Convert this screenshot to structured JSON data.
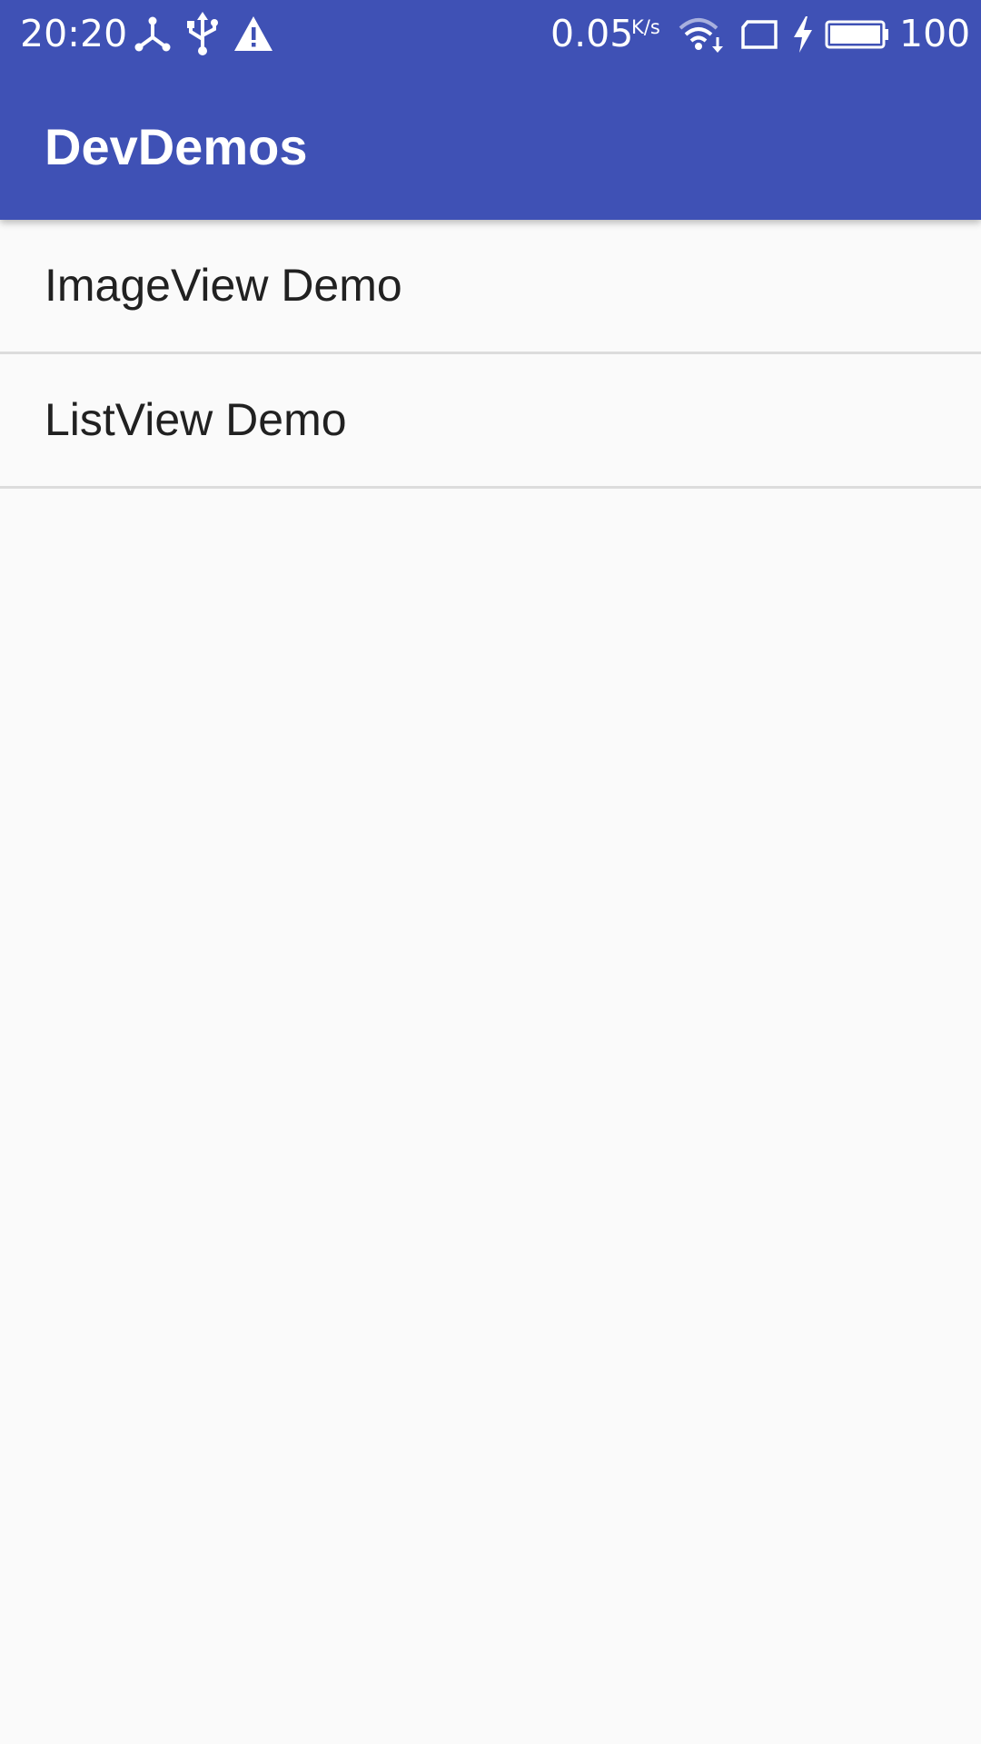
{
  "status_bar": {
    "time": "20:20",
    "left_icons": [
      "network-share-icon",
      "usb-icon",
      "warning-icon"
    ],
    "net_speed_value": "0.05",
    "net_speed_unit": "K/s",
    "right_icons": [
      "wifi-icon",
      "sim-card-icon",
      "charging-bolt-icon",
      "battery-icon"
    ],
    "battery_level": "100"
  },
  "app_bar": {
    "title": "DevDemos",
    "color": "#3f51b5"
  },
  "list": {
    "items": [
      {
        "label": "ImageView Demo"
      },
      {
        "label": "ListView Demo"
      }
    ]
  },
  "background_color": "#fafafa"
}
